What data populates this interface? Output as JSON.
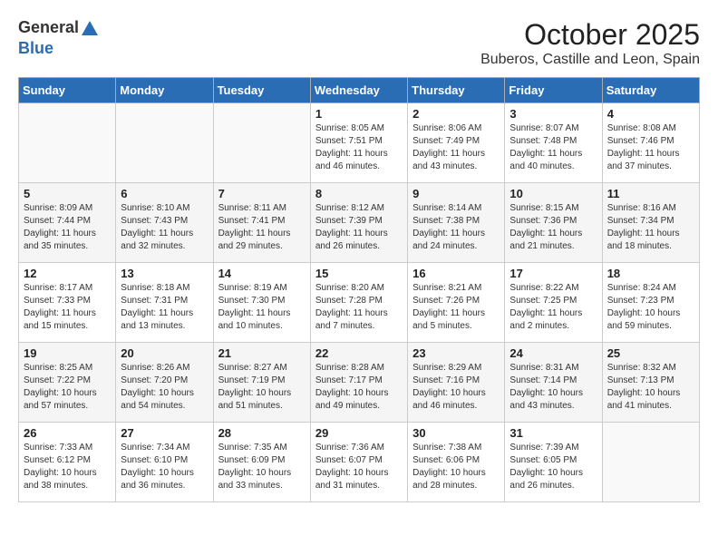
{
  "header": {
    "logo_general": "General",
    "logo_blue": "Blue",
    "title": "October 2025",
    "subtitle": "Buberos, Castille and Leon, Spain"
  },
  "weekdays": [
    "Sunday",
    "Monday",
    "Tuesday",
    "Wednesday",
    "Thursday",
    "Friday",
    "Saturday"
  ],
  "weeks": [
    [
      null,
      null,
      null,
      {
        "day": "1",
        "sunrise": "Sunrise: 8:05 AM",
        "sunset": "Sunset: 7:51 PM",
        "daylight": "Daylight: 11 hours and 46 minutes."
      },
      {
        "day": "2",
        "sunrise": "Sunrise: 8:06 AM",
        "sunset": "Sunset: 7:49 PM",
        "daylight": "Daylight: 11 hours and 43 minutes."
      },
      {
        "day": "3",
        "sunrise": "Sunrise: 8:07 AM",
        "sunset": "Sunset: 7:48 PM",
        "daylight": "Daylight: 11 hours and 40 minutes."
      },
      {
        "day": "4",
        "sunrise": "Sunrise: 8:08 AM",
        "sunset": "Sunset: 7:46 PM",
        "daylight": "Daylight: 11 hours and 37 minutes."
      }
    ],
    [
      {
        "day": "5",
        "sunrise": "Sunrise: 8:09 AM",
        "sunset": "Sunset: 7:44 PM",
        "daylight": "Daylight: 11 hours and 35 minutes."
      },
      {
        "day": "6",
        "sunrise": "Sunrise: 8:10 AM",
        "sunset": "Sunset: 7:43 PM",
        "daylight": "Daylight: 11 hours and 32 minutes."
      },
      {
        "day": "7",
        "sunrise": "Sunrise: 8:11 AM",
        "sunset": "Sunset: 7:41 PM",
        "daylight": "Daylight: 11 hours and 29 minutes."
      },
      {
        "day": "8",
        "sunrise": "Sunrise: 8:12 AM",
        "sunset": "Sunset: 7:39 PM",
        "daylight": "Daylight: 11 hours and 26 minutes."
      },
      {
        "day": "9",
        "sunrise": "Sunrise: 8:14 AM",
        "sunset": "Sunset: 7:38 PM",
        "daylight": "Daylight: 11 hours and 24 minutes."
      },
      {
        "day": "10",
        "sunrise": "Sunrise: 8:15 AM",
        "sunset": "Sunset: 7:36 PM",
        "daylight": "Daylight: 11 hours and 21 minutes."
      },
      {
        "day": "11",
        "sunrise": "Sunrise: 8:16 AM",
        "sunset": "Sunset: 7:34 PM",
        "daylight": "Daylight: 11 hours and 18 minutes."
      }
    ],
    [
      {
        "day": "12",
        "sunrise": "Sunrise: 8:17 AM",
        "sunset": "Sunset: 7:33 PM",
        "daylight": "Daylight: 11 hours and 15 minutes."
      },
      {
        "day": "13",
        "sunrise": "Sunrise: 8:18 AM",
        "sunset": "Sunset: 7:31 PM",
        "daylight": "Daylight: 11 hours and 13 minutes."
      },
      {
        "day": "14",
        "sunrise": "Sunrise: 8:19 AM",
        "sunset": "Sunset: 7:30 PM",
        "daylight": "Daylight: 11 hours and 10 minutes."
      },
      {
        "day": "15",
        "sunrise": "Sunrise: 8:20 AM",
        "sunset": "Sunset: 7:28 PM",
        "daylight": "Daylight: 11 hours and 7 minutes."
      },
      {
        "day": "16",
        "sunrise": "Sunrise: 8:21 AM",
        "sunset": "Sunset: 7:26 PM",
        "daylight": "Daylight: 11 hours and 5 minutes."
      },
      {
        "day": "17",
        "sunrise": "Sunrise: 8:22 AM",
        "sunset": "Sunset: 7:25 PM",
        "daylight": "Daylight: 11 hours and 2 minutes."
      },
      {
        "day": "18",
        "sunrise": "Sunrise: 8:24 AM",
        "sunset": "Sunset: 7:23 PM",
        "daylight": "Daylight: 10 hours and 59 minutes."
      }
    ],
    [
      {
        "day": "19",
        "sunrise": "Sunrise: 8:25 AM",
        "sunset": "Sunset: 7:22 PM",
        "daylight": "Daylight: 10 hours and 57 minutes."
      },
      {
        "day": "20",
        "sunrise": "Sunrise: 8:26 AM",
        "sunset": "Sunset: 7:20 PM",
        "daylight": "Daylight: 10 hours and 54 minutes."
      },
      {
        "day": "21",
        "sunrise": "Sunrise: 8:27 AM",
        "sunset": "Sunset: 7:19 PM",
        "daylight": "Daylight: 10 hours and 51 minutes."
      },
      {
        "day": "22",
        "sunrise": "Sunrise: 8:28 AM",
        "sunset": "Sunset: 7:17 PM",
        "daylight": "Daylight: 10 hours and 49 minutes."
      },
      {
        "day": "23",
        "sunrise": "Sunrise: 8:29 AM",
        "sunset": "Sunset: 7:16 PM",
        "daylight": "Daylight: 10 hours and 46 minutes."
      },
      {
        "day": "24",
        "sunrise": "Sunrise: 8:31 AM",
        "sunset": "Sunset: 7:14 PM",
        "daylight": "Daylight: 10 hours and 43 minutes."
      },
      {
        "day": "25",
        "sunrise": "Sunrise: 8:32 AM",
        "sunset": "Sunset: 7:13 PM",
        "daylight": "Daylight: 10 hours and 41 minutes."
      }
    ],
    [
      {
        "day": "26",
        "sunrise": "Sunrise: 7:33 AM",
        "sunset": "Sunset: 6:12 PM",
        "daylight": "Daylight: 10 hours and 38 minutes."
      },
      {
        "day": "27",
        "sunrise": "Sunrise: 7:34 AM",
        "sunset": "Sunset: 6:10 PM",
        "daylight": "Daylight: 10 hours and 36 minutes."
      },
      {
        "day": "28",
        "sunrise": "Sunrise: 7:35 AM",
        "sunset": "Sunset: 6:09 PM",
        "daylight": "Daylight: 10 hours and 33 minutes."
      },
      {
        "day": "29",
        "sunrise": "Sunrise: 7:36 AM",
        "sunset": "Sunset: 6:07 PM",
        "daylight": "Daylight: 10 hours and 31 minutes."
      },
      {
        "day": "30",
        "sunrise": "Sunrise: 7:38 AM",
        "sunset": "Sunset: 6:06 PM",
        "daylight": "Daylight: 10 hours and 28 minutes."
      },
      {
        "day": "31",
        "sunrise": "Sunrise: 7:39 AM",
        "sunset": "Sunset: 6:05 PM",
        "daylight": "Daylight: 10 hours and 26 minutes."
      },
      null
    ]
  ]
}
